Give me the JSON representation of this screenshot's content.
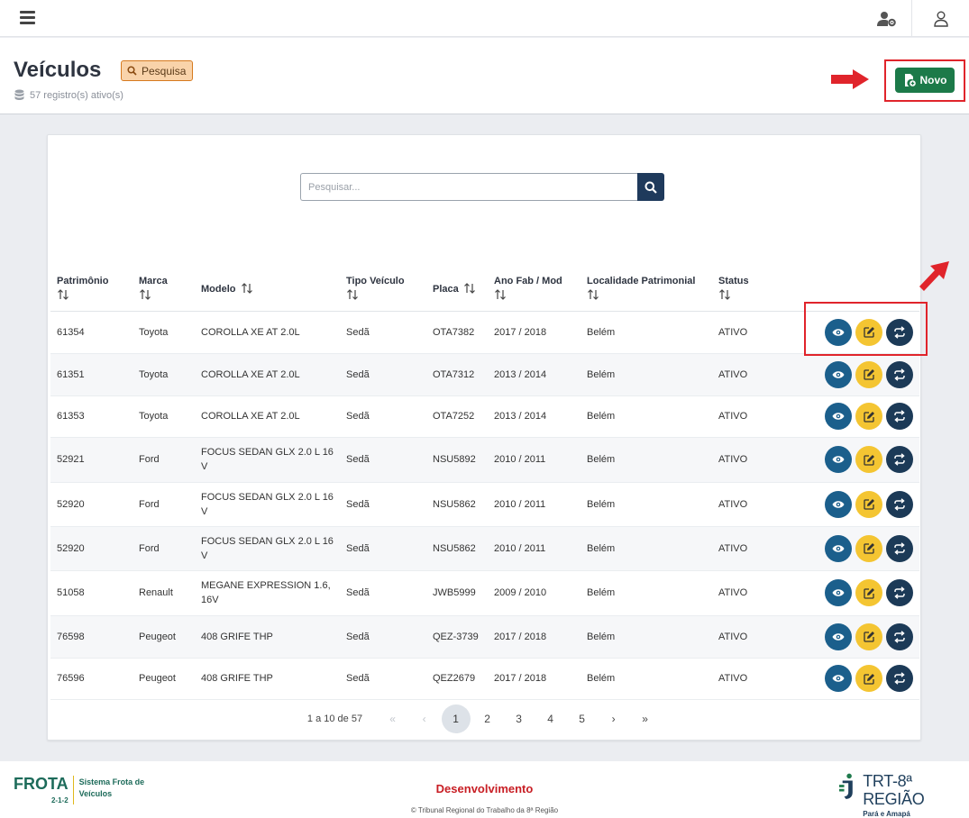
{
  "colors": {
    "primary": "#1c7a49",
    "navy": "#1f3a5c",
    "view": "#1b5f8c",
    "edit": "#f4c532",
    "swap": "#1c3a57",
    "annotation": "#e0242b",
    "env": "#c81e24"
  },
  "topbar": {
    "menu_icon": "hamburger-icon",
    "settings_icon": "user-settings-icon",
    "profile_icon": "user-icon"
  },
  "header": {
    "title": "Veículos",
    "search_badge": "Pesquisa",
    "records": "57 registro(s) ativo(s)",
    "new_button": "Novo"
  },
  "search": {
    "placeholder": "Pesquisar..."
  },
  "table": {
    "headers": {
      "patrimonio": "Patrimônio",
      "marca": "Marca",
      "modelo": "Modelo",
      "tipo": "Tipo Veículo",
      "placa": "Placa",
      "ano": "Ano Fab / Mod",
      "localidade": "Localidade Patrimonial",
      "status": "Status"
    },
    "rows": [
      {
        "patrimonio": "61354",
        "marca": "Toyota",
        "modelo": "COROLLA XE AT 2.0L",
        "tipo": "Sedã",
        "placa": "OTA7382",
        "ano": "2017 / 2018",
        "localidade": "Belém",
        "status": "ATIVO"
      },
      {
        "patrimonio": "61351",
        "marca": "Toyota",
        "modelo": "COROLLA XE AT 2.0L",
        "tipo": "Sedã",
        "placa": "OTA7312",
        "ano": "2013 / 2014",
        "localidade": "Belém",
        "status": "ATIVO"
      },
      {
        "patrimonio": "61353",
        "marca": "Toyota",
        "modelo": "COROLLA XE AT 2.0L",
        "tipo": "Sedã",
        "placa": "OTA7252",
        "ano": "2013 / 2014",
        "localidade": "Belém",
        "status": "ATIVO"
      },
      {
        "patrimonio": "52921",
        "marca": "Ford",
        "modelo": "FOCUS SEDAN GLX 2.0 L 16 V",
        "tipo": "Sedã",
        "placa": "NSU5892",
        "ano": "2010 / 2011",
        "localidade": "Belém",
        "status": "ATIVO"
      },
      {
        "patrimonio": "52920",
        "marca": "Ford",
        "modelo": "FOCUS SEDAN GLX 2.0 L 16 V",
        "tipo": "Sedã",
        "placa": "NSU5862",
        "ano": "2010 / 2011",
        "localidade": "Belém",
        "status": "ATIVO"
      },
      {
        "patrimonio": "52920",
        "marca": "Ford",
        "modelo": "FOCUS SEDAN GLX 2.0 L 16 V",
        "tipo": "Sedã",
        "placa": "NSU5862",
        "ano": "2010 / 2011",
        "localidade": "Belém",
        "status": "ATIVO"
      },
      {
        "patrimonio": "51058",
        "marca": "Renault",
        "modelo": "MEGANE EXPRESSION 1.6, 16V",
        "tipo": "Sedã",
        "placa": "JWB5999",
        "ano": "2009 / 2010",
        "localidade": "Belém",
        "status": "ATIVO"
      },
      {
        "patrimonio": "76598",
        "marca": "Peugeot",
        "modelo": "408 GRIFE THP",
        "tipo": "Sedã",
        "placa": "QEZ-3739",
        "ano": "2017 / 2018",
        "localidade": "Belém",
        "status": "ATIVO"
      },
      {
        "patrimonio": "76596",
        "marca": "Peugeot",
        "modelo": "408 GRIFE THP",
        "tipo": "Sedã",
        "placa": "QEZ2679",
        "ano": "2017 / 2018",
        "localidade": "Belém",
        "status": "ATIVO"
      }
    ],
    "row_actions": [
      "eye-icon",
      "edit-icon",
      "swap-icon"
    ]
  },
  "pagination": {
    "range": "1 a 10 de 57",
    "first": "«",
    "prev": "‹",
    "pages": [
      "1",
      "2",
      "3",
      "4",
      "5"
    ],
    "current": "1",
    "next": "›",
    "last": "»"
  },
  "footer": {
    "brand_name": "FROTA",
    "brand_code": "2-1-2",
    "brand_subtitle": "Sistema Frota de Veículos",
    "environment": "Desenvolvimento",
    "copyright": "© Tribunal Regional do Trabalho da 8ª Região",
    "org_name": "TRT-8ª REGIÃO",
    "org_subtitle": "Pará e Amapá"
  }
}
